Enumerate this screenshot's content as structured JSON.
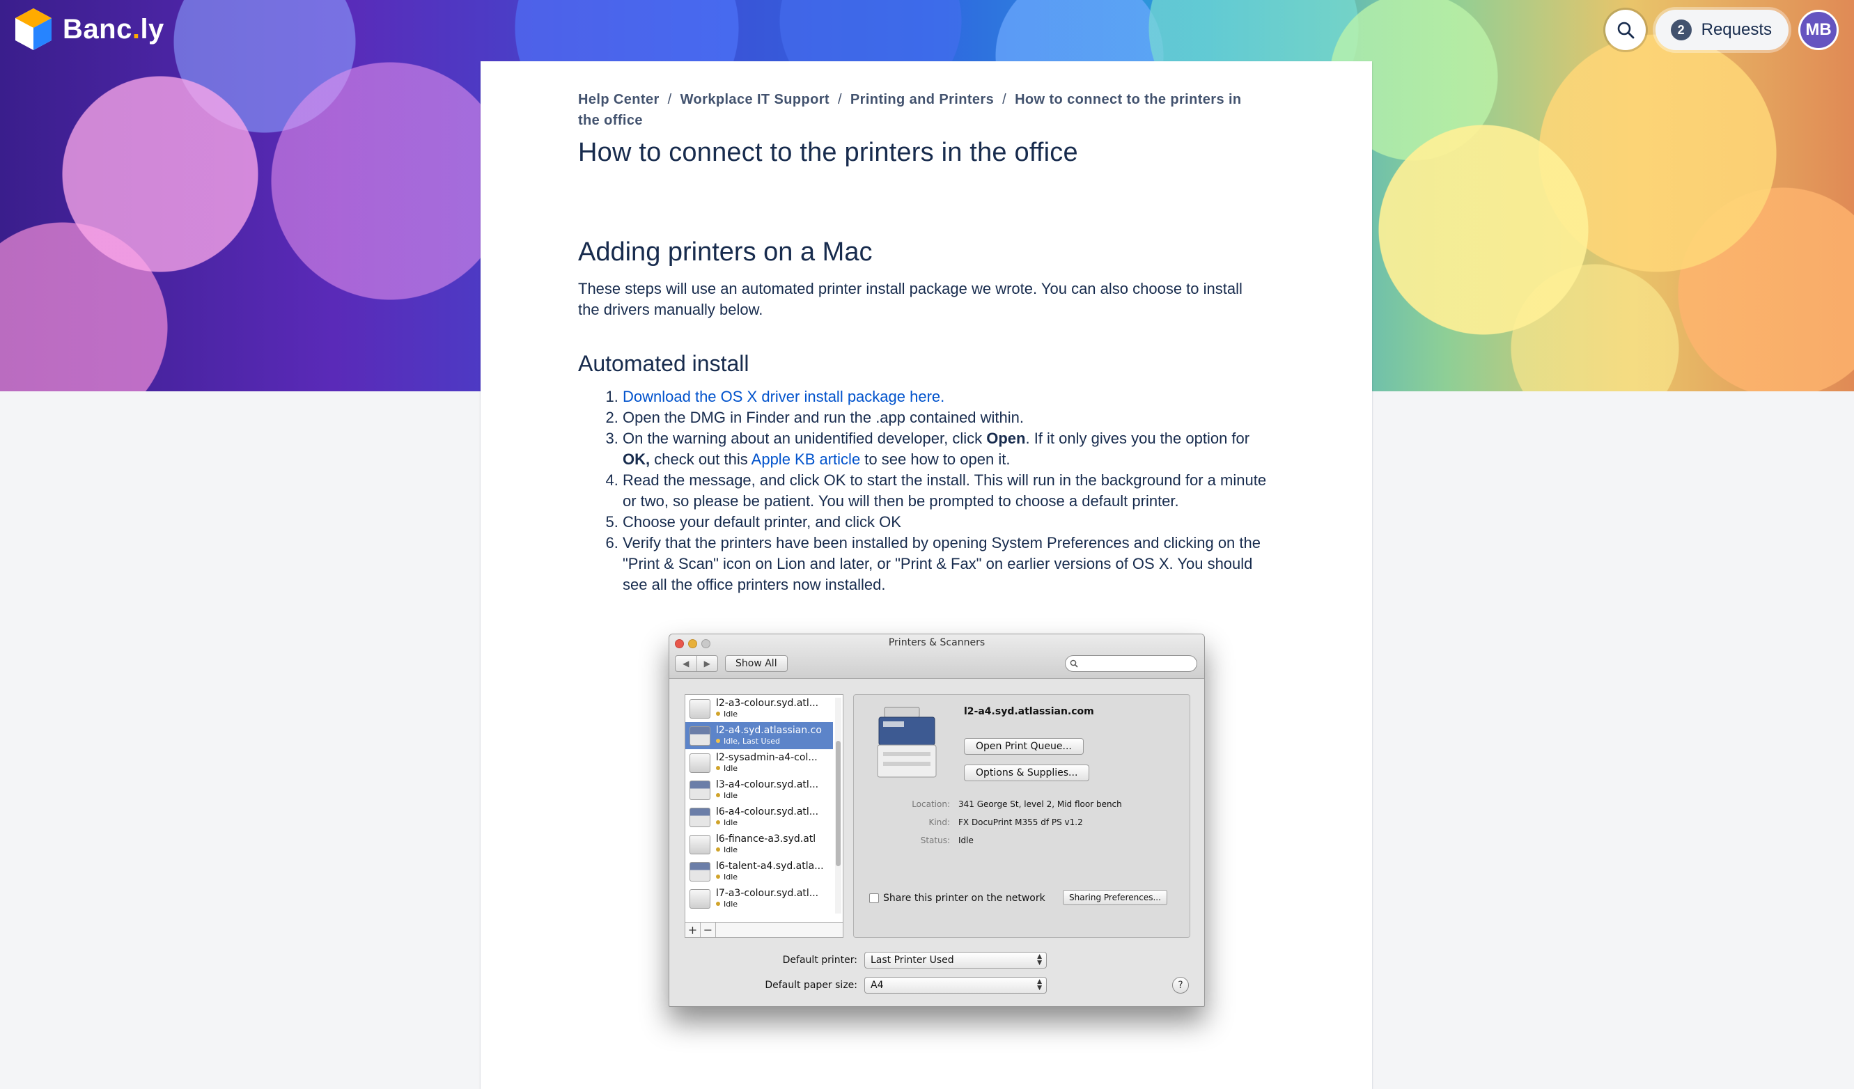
{
  "brand": {
    "name_main": "Banc",
    "name_dot": ".",
    "name_end": "ly",
    "accent": "#ffab00"
  },
  "nav": {
    "requests_count": "2",
    "requests_label": "Requests",
    "avatar_initials": "MB"
  },
  "breadcrumb": [
    "Help Center",
    "Workplace IT Support",
    "Printing and Printers",
    "How to connect to the printers in the office"
  ],
  "article": {
    "title": "How to connect to the printers in the office",
    "mac_heading": "Adding printers on a Mac",
    "mac_intro": "These steps will use an automated printer install package we wrote. You can also choose to install the drivers manually below.",
    "auto_heading": "Automated install",
    "step1_link": "Download the OS X driver install package here.",
    "step2": "Open the DMG in Finder and run the .app contained within.",
    "step3_a": "On the warning about an unidentified developer, click ",
    "step3_open": "Open",
    "step3_b": ". If it only gives you the option for ",
    "step3_ok": "OK,",
    "step3_c": " check out this ",
    "step3_link": "Apple KB article",
    "step3_d": " to see how to open it.",
    "step4": "Read the message, and click OK to start the install. This will run in the background for a minute or two, so please be patient. You will then be prompted to choose a default printer.",
    "step5": "Choose your default printer, and click OK",
    "step6": "Verify that the printers have been installed by opening System Preferences and clicking on the \"Print & Scan\" icon on Lion and later, or \"Print & Fax\" on earlier versions of OS X. You should see all the office printers now installed."
  },
  "mac_window": {
    "title": "Printers & Scanners",
    "show_all": "Show All",
    "printers": [
      {
        "name": "l2-a3-colour.syd.atl...",
        "status": "Idle",
        "selected": false,
        "dark": false
      },
      {
        "name": "l2-a4.syd.atlassian.co",
        "status": "Idle, Last Used",
        "selected": true,
        "dark": true
      },
      {
        "name": "l2-sysadmin-a4-col...",
        "status": "Idle",
        "selected": false,
        "dark": false
      },
      {
        "name": "l3-a4-colour.syd.atl...",
        "status": "Idle",
        "selected": false,
        "dark": true
      },
      {
        "name": "l6-a4-colour.syd.atl...",
        "status": "Idle",
        "selected": false,
        "dark": true
      },
      {
        "name": "l6-finance-a3.syd.atl",
        "status": "Idle",
        "selected": false,
        "dark": false
      },
      {
        "name": "l6-talent-a4.syd.atla...",
        "status": "Idle",
        "selected": false,
        "dark": true
      },
      {
        "name": "l7-a3-colour.syd.atl...",
        "status": "Idle",
        "selected": false,
        "dark": false
      }
    ],
    "add_label": "+",
    "remove_label": "−",
    "selected_name": "l2-a4.syd.atlassian.com",
    "open_queue": "Open Print Queue...",
    "options_supplies": "Options & Supplies...",
    "location_label": "Location:",
    "location": "341 George St, level 2, Mid floor bench",
    "kind_label": "Kind:",
    "kind": "FX DocuPrint M355 df PS v1.2",
    "status_label": "Status:",
    "status": "Idle",
    "share_label": "Share this printer on the network",
    "sharing_prefs": "Sharing Preferences...",
    "default_printer_label": "Default printer:",
    "default_printer": "Last Printer Used",
    "paper_size_label": "Default paper size:",
    "paper_size": "A4",
    "help": "?"
  }
}
